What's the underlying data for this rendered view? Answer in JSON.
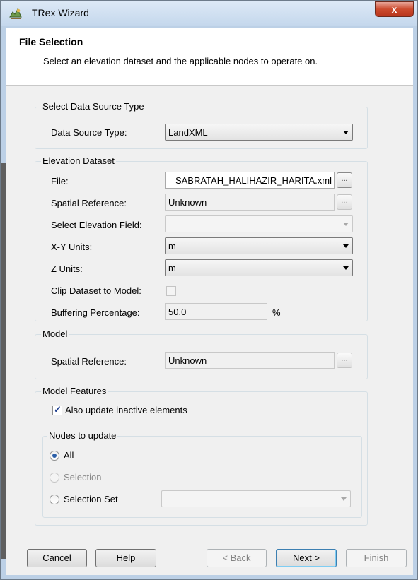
{
  "window": {
    "title": "TRex Wizard",
    "close_label": "x"
  },
  "header": {
    "title": "File Selection",
    "subtitle": "Select an elevation dataset and the applicable nodes to operate on."
  },
  "source_group": {
    "title": "Select Data Source Type",
    "type_label": "Data Source Type:",
    "type_value": "LandXML"
  },
  "elevation_group": {
    "title": "Elevation Dataset",
    "file_label": "File:",
    "file_value": "SABRATAH_HALIHAZIR_HARITA.xml",
    "browse_label": "...",
    "spatial_label": "Spatial Reference:",
    "spatial_value": "Unknown",
    "elev_field_label": "Select Elevation Field:",
    "elev_field_value": "",
    "xy_units_label": "X-Y Units:",
    "xy_units_value": "m",
    "z_units_label": "Z Units:",
    "z_units_value": "m",
    "clip_label": "Clip Dataset to Model:",
    "clip_checked": false,
    "buffer_label": "Buffering Percentage:",
    "buffer_value": "50,0",
    "buffer_unit": "%"
  },
  "model_group": {
    "title": "Model",
    "spatial_label": "Spatial Reference:",
    "spatial_value": "Unknown",
    "browse_label": "..."
  },
  "features_group": {
    "title": "Model Features",
    "inactive_label": "Also update inactive elements",
    "inactive_checked": true,
    "nodes_group": {
      "title": "Nodes to update",
      "options": [
        "All",
        "Selection",
        "Selection Set"
      ],
      "selected": "All",
      "selection_set_value": ""
    }
  },
  "buttons": {
    "cancel": "Cancel",
    "help": "Help",
    "back": "< Back",
    "next": "Next >",
    "finish": "Finish"
  }
}
